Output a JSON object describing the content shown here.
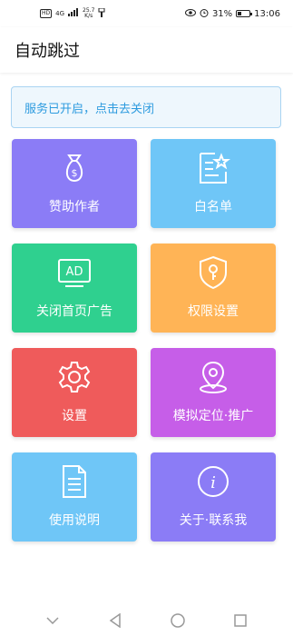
{
  "status_bar": {
    "time": "13:06",
    "battery_percent": "31%",
    "net_speed": "25.7",
    "net_unit": "K/s",
    "hd": "HD",
    "signal": "4G"
  },
  "app_bar": {
    "title": "自动跳过"
  },
  "notice": {
    "text": "服务已开启，点击去关闭"
  },
  "tiles": [
    {
      "label": "赞助作者",
      "color": "#8b7cf6",
      "icon": "money-bag-icon"
    },
    {
      "label": "白名单",
      "color": "#6fc6f7",
      "icon": "whitelist-icon"
    },
    {
      "label": "关闭首页广告",
      "color": "#2fd08f",
      "icon": "ad-icon",
      "icon_text": "AD"
    },
    {
      "label": "权限设置",
      "color": "#ffb456",
      "icon": "shield-key-icon"
    },
    {
      "label": "设置",
      "color": "#ef5b5b",
      "icon": "gear-icon"
    },
    {
      "label": "模拟定位·推广",
      "color": "#c65ee8",
      "icon": "location-pin-icon"
    },
    {
      "label": "使用说明",
      "color": "#6fc6f7",
      "icon": "document-icon"
    },
    {
      "label": "关于·联系我",
      "color": "#8b7cf6",
      "icon": "info-icon"
    }
  ]
}
